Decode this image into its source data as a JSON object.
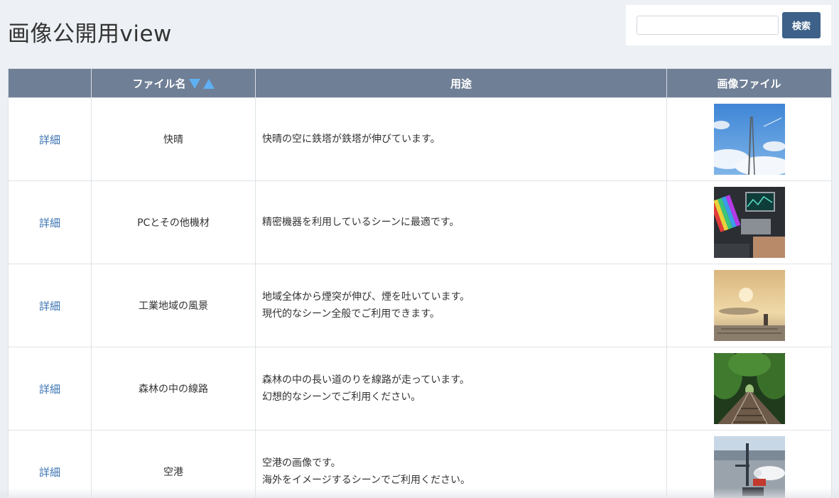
{
  "header": {
    "title": "画像公開用view",
    "search": {
      "value": "",
      "placeholder": "",
      "button_label": "検索"
    }
  },
  "table": {
    "columns": [
      "",
      "ファイル名",
      "用途",
      "画像ファイル"
    ],
    "sort_icons": [
      "sort-down-icon",
      "sort-up-icon"
    ],
    "rows": [
      {
        "detail": "詳細",
        "name": "快晴",
        "description": [
          "快晴の空に鉄塔が鉄塔が伸びています。"
        ],
        "image_icon": "clear-sky-tower-thumbnail"
      },
      {
        "detail": "詳細",
        "name": "PCとその他機材",
        "description": [
          "精密機器を利用しているシーンに最適です。"
        ],
        "image_icon": "pc-equipment-thumbnail"
      },
      {
        "detail": "詳細",
        "name": "工業地域の風景",
        "description": [
          "地域全体から煙突が伸び、煙を吐いています。",
          "現代的なシーン全般でご利用できます。"
        ],
        "image_icon": "industrial-area-thumbnail"
      },
      {
        "detail": "詳細",
        "name": "森林の中の線路",
        "description": [
          "森林の中の長い道のりを線路が走っています。",
          "幻想的なシーンでご利用ください。"
        ],
        "image_icon": "forest-railway-thumbnail"
      },
      {
        "detail": "詳細",
        "name": "空港",
        "description": [
          "空港の画像です。",
          "海外をイメージするシーンでご利用ください。"
        ],
        "image_icon": "airport-thumbnail"
      }
    ]
  },
  "colors": {
    "header_bg": "#6f7f96",
    "accent_button": "#3d6189",
    "link": "#3b73b3",
    "sort_icon": "#5fb0f2",
    "page_bg": "#edf1f5"
  }
}
